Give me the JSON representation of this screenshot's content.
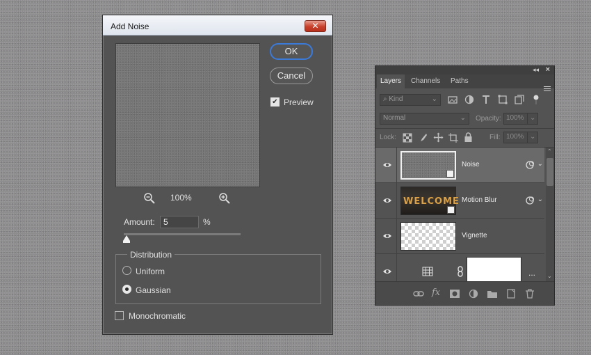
{
  "dialog": {
    "title": "Add Noise",
    "close_label": "✕",
    "ok_label": "OK",
    "cancel_label": "Cancel",
    "preview_label": "Preview",
    "preview_checked": true,
    "zoom_level": "100%",
    "amount_label": "Amount:",
    "amount_value": "5",
    "amount_unit": "%",
    "amount_slider_value": 5,
    "distribution_label": "Distribution",
    "distribution_options": [
      "Uniform",
      "Gaussian"
    ],
    "distribution_selected": "Gaussian",
    "monochromatic_label": "Monochromatic",
    "monochromatic_checked": false
  },
  "layers_panel": {
    "tabs": [
      "Layers",
      "Channels",
      "Paths"
    ],
    "active_tab": "Layers",
    "kind_placeholder": "Kind",
    "blend_mode": "Normal",
    "opacity_label": "Opacity:",
    "opacity_value": "100%",
    "lock_label": "Lock:",
    "fill_label": "Fill:",
    "fill_value": "100%",
    "layers": [
      {
        "name": "Noise",
        "selected": true
      },
      {
        "name": "Motion Blur",
        "thumb_text": "WELCOME"
      },
      {
        "name": "Vignette"
      },
      {
        "name": "",
        "more": "..."
      }
    ]
  },
  "colors": {
    "accent": "#3b7ad9",
    "panel_bg": "#535353",
    "selected_row": "#6a6a6a"
  }
}
